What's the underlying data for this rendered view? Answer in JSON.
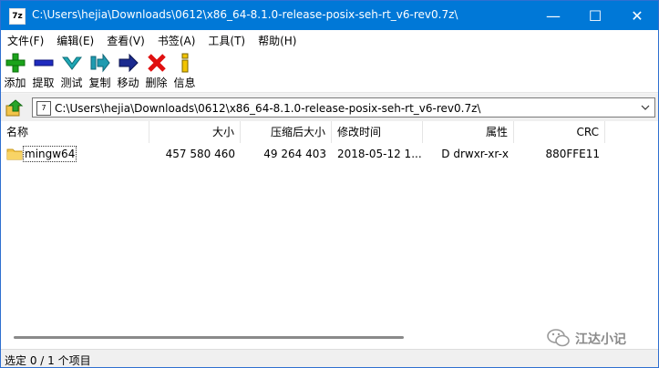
{
  "window": {
    "app_icon": "7z",
    "title": "C:\\Users\\hejia\\Downloads\\0612\\x86_64-8.1.0-release-posix-seh-rt_v6-rev0.7z\\",
    "controls": {
      "minimize": "—",
      "maximize": "☐",
      "close": "✕"
    }
  },
  "menu": [
    "文件(F)",
    "编辑(E)",
    "查看(V)",
    "书签(A)",
    "工具(T)",
    "帮助(H)"
  ],
  "toolbar": {
    "buttons": [
      {
        "label": "添加",
        "icon": "add-icon",
        "color": "#1aa31a"
      },
      {
        "label": "提取",
        "icon": "extract-icon",
        "color": "#1f2bbf"
      },
      {
        "label": "测试",
        "icon": "test-icon",
        "color": "#1fa7b5"
      },
      {
        "label": "复制",
        "icon": "copy-icon",
        "color": "#1f9bb0"
      },
      {
        "label": "移动",
        "icon": "move-icon",
        "color": "#1b2a8f"
      },
      {
        "label": "删除",
        "icon": "delete-icon",
        "color": "#e01010"
      },
      {
        "label": "信息",
        "icon": "info-icon",
        "color": "#e0b000"
      }
    ]
  },
  "address": {
    "icon": "7",
    "path": "C:\\Users\\hejia\\Downloads\\0612\\x86_64-8.1.0-release-posix-seh-rt_v6-rev0.7z\\"
  },
  "columns": [
    "名称",
    "大小",
    "压缩后大小",
    "修改时间",
    "属性",
    "CRC"
  ],
  "rows": [
    {
      "name": "mingw64",
      "size": "457 580 460",
      "packed": "49 264 403",
      "modified": "2018-05-12 1...",
      "attributes": "D drwxr-xr-x",
      "crc": "880FFE11"
    }
  ],
  "status": "选定 0 / 1 个项目",
  "watermark": "江达小记",
  "colors": {
    "titlebar": "#0078d7",
    "accent": "#2f6fd0"
  }
}
